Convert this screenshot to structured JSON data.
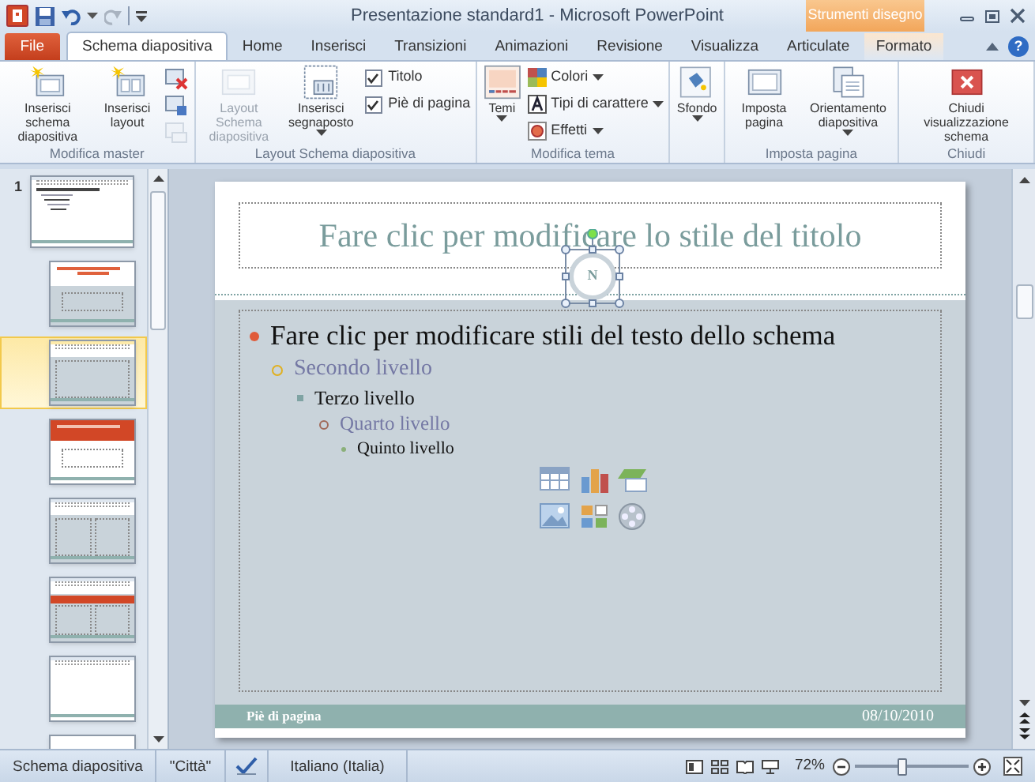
{
  "window": {
    "title": "Presentazione standard1 - Microsoft PowerPoint",
    "contextual_group": "Strumenti disegno",
    "help": "?"
  },
  "tabs": [
    {
      "label": "File",
      "kind": "file",
      "selected": false
    },
    {
      "label": "Schema diapositiva",
      "kind": "tab",
      "selected": true
    },
    {
      "label": "Home",
      "kind": "tab",
      "selected": false
    },
    {
      "label": "Inserisci",
      "kind": "tab",
      "selected": false
    },
    {
      "label": "Transizioni",
      "kind": "tab",
      "selected": false
    },
    {
      "label": "Animazioni",
      "kind": "tab",
      "selected": false
    },
    {
      "label": "Revisione",
      "kind": "tab",
      "selected": false
    },
    {
      "label": "Visualizza",
      "kind": "tab",
      "selected": false
    },
    {
      "label": "Articulate",
      "kind": "tab",
      "selected": false
    },
    {
      "label": "Formato",
      "kind": "contextual",
      "selected": false
    }
  ],
  "ribbon": [
    {
      "label": "Modifica master",
      "items": [
        {
          "kind": "large",
          "label": "Inserisci schema diapositiva",
          "disabled": false,
          "dropdown": false
        },
        {
          "kind": "large",
          "label": "Inserisci layout",
          "disabled": false,
          "dropdown": false
        },
        {
          "kind": "icon",
          "disabled": false
        },
        {
          "kind": "icon",
          "disabled": false
        },
        {
          "kind": "icon",
          "disabled": true
        }
      ]
    },
    {
      "label": "Layout Schema diapositiva",
      "items": [
        {
          "kind": "large",
          "label": "Layout Schema diapositiva",
          "disabled": true,
          "dropdown": false
        },
        {
          "kind": "large",
          "label": "Inserisci segnaposto",
          "disabled": false,
          "dropdown": true
        },
        {
          "kind": "check",
          "label": "Titolo",
          "checked": true
        },
        {
          "kind": "check",
          "label": "Piè di pagina",
          "checked": true
        }
      ]
    },
    {
      "label": "Modifica tema",
      "items": [
        {
          "kind": "large",
          "label": "Temi",
          "disabled": false,
          "dropdown": true
        },
        {
          "kind": "menu",
          "label": "Colori",
          "dropdown": true
        },
        {
          "kind": "menu",
          "label": "Tipi di carattere",
          "dropdown": true
        },
        {
          "kind": "menu",
          "label": "Effetti",
          "dropdown": true
        }
      ]
    },
    {
      "items": [
        {
          "kind": "large",
          "label": "Sfondo",
          "disabled": false,
          "dropdown": true
        }
      ]
    },
    {
      "label": "Imposta pagina",
      "items": [
        {
          "kind": "large",
          "label": "Imposta pagina",
          "disabled": false,
          "dropdown": false
        },
        {
          "kind": "large",
          "label": "Orientamento diapositiva",
          "disabled": false,
          "dropdown": true
        }
      ]
    },
    {
      "label": "Chiudi",
      "items": [
        {
          "kind": "large",
          "label": "Chiudi visualizzazione schema",
          "disabled": false,
          "dropdown": false
        }
      ]
    }
  ],
  "thumbnails": [
    {
      "number": "1",
      "kind": "master",
      "selected": false
    },
    {
      "kind": "title",
      "selected": false
    },
    {
      "kind": "content",
      "selected": true
    },
    {
      "kind": "section",
      "selected": false
    },
    {
      "kind": "two_content",
      "selected": false
    },
    {
      "kind": "comparison",
      "selected": false
    },
    {
      "kind": "title_only",
      "selected": false
    },
    {
      "kind": "blank",
      "selected": false
    }
  ],
  "slide": {
    "title": "Fare clic per modificare lo stile del titolo",
    "logo": {
      "text": "N"
    },
    "body": [
      {
        "text": "Fare clic per modificare stili del testo dello schema",
        "children": [
          {
            "text": "Secondo livello",
            "children": [
              {
                "text": "Terzo livello",
                "children": [
                  {
                    "text": "Quarto livello",
                    "children": [
                      {
                        "text": "Quinto livello"
                      }
                    ]
                  }
                ]
              }
            ]
          }
        ]
      }
    ],
    "footer": "Piè di pagina",
    "date": "08/10/2010"
  },
  "status_bar": {
    "view": "Schema diapositiva",
    "theme": "\"Città\"",
    "language": "Italiano (Italia)",
    "zoom": "72%",
    "zoom_slider": {
      "level": 0.42
    }
  }
}
